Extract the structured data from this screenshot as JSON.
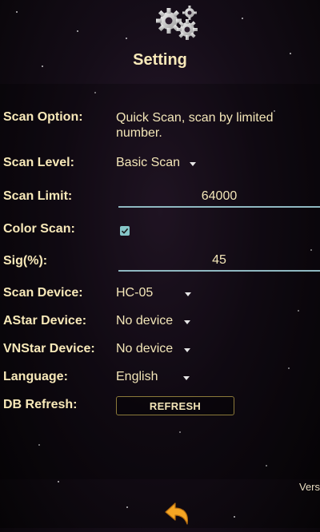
{
  "header": {
    "title": "Setting",
    "icon": "gears-icon"
  },
  "settings": {
    "scan_option": {
      "label": "Scan Option:",
      "value": "Quick Scan, scan by limited number."
    },
    "scan_level": {
      "label": "Scan Level:",
      "value": "Basic Scan"
    },
    "scan_limit": {
      "label": "Scan Limit:",
      "value": "64000"
    },
    "color_scan": {
      "label": "Color Scan:",
      "checked": true
    },
    "sig": {
      "label": "Sig(%):",
      "value": "45"
    },
    "scan_device": {
      "label": "Scan Device:",
      "value": "HC-05"
    },
    "astar_device": {
      "label": "AStar Device:",
      "value": "No device"
    },
    "vnstar_device": {
      "label": "VNStar Device:",
      "value": "No device"
    },
    "language": {
      "label": "Language:",
      "value": "English"
    },
    "db_refresh": {
      "label": "DB Refresh:",
      "button": "REFRESH"
    }
  },
  "footer": {
    "version": "Vers"
  },
  "colors": {
    "text": "#f8e9b9",
    "accent": "#86c6c8",
    "back_arrow": "#f5a623"
  }
}
